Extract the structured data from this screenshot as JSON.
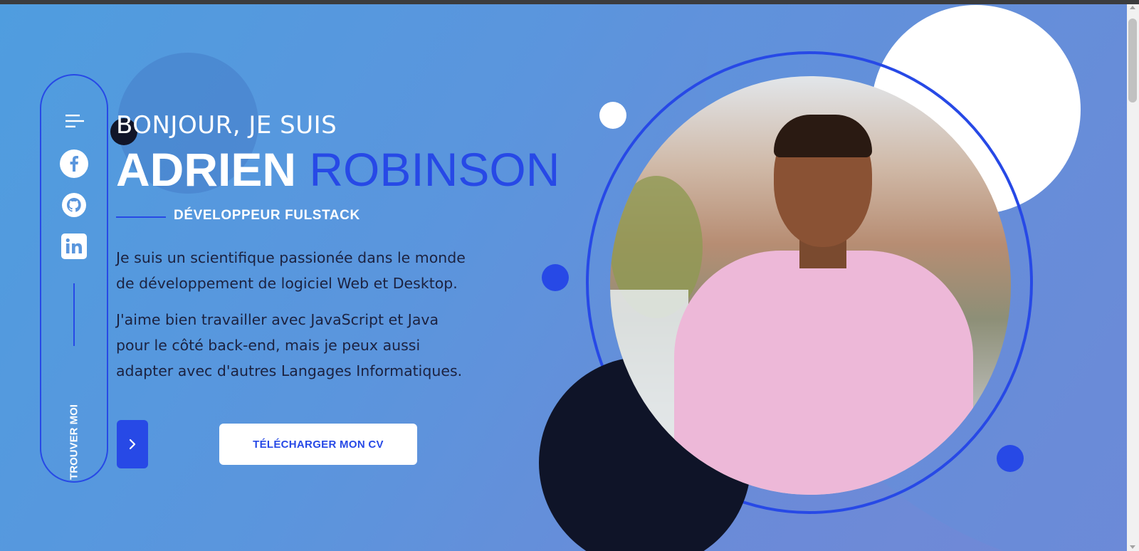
{
  "hero": {
    "greeting": "BONJOUR, JE SUIS",
    "first_name": "ADRIEN",
    "last_name": "ROBINSON",
    "role": "DÉVELOPPEUR FULSTACK",
    "paragraph_1": "Je suis un scientifique passionée dans le monde de développement de logiciel Web et Desktop.",
    "paragraph_2": "J'aime bien travailler avec JavaScript et Java pour le côté back-end, mais je peux aussi adapter avec d'autres Langages Informatiques.",
    "cv_button_label": "TÉLÉCHARGER MON CV"
  },
  "sidebar": {
    "label": "TROUVER MOI",
    "icons": [
      "menu-icon",
      "facebook-icon",
      "github-icon",
      "linkedin-icon"
    ]
  },
  "colors": {
    "accent": "#2749e6",
    "navy": "#0f1428",
    "gradient_start": "#4f9ddf",
    "gradient_end": "#7288d6"
  }
}
